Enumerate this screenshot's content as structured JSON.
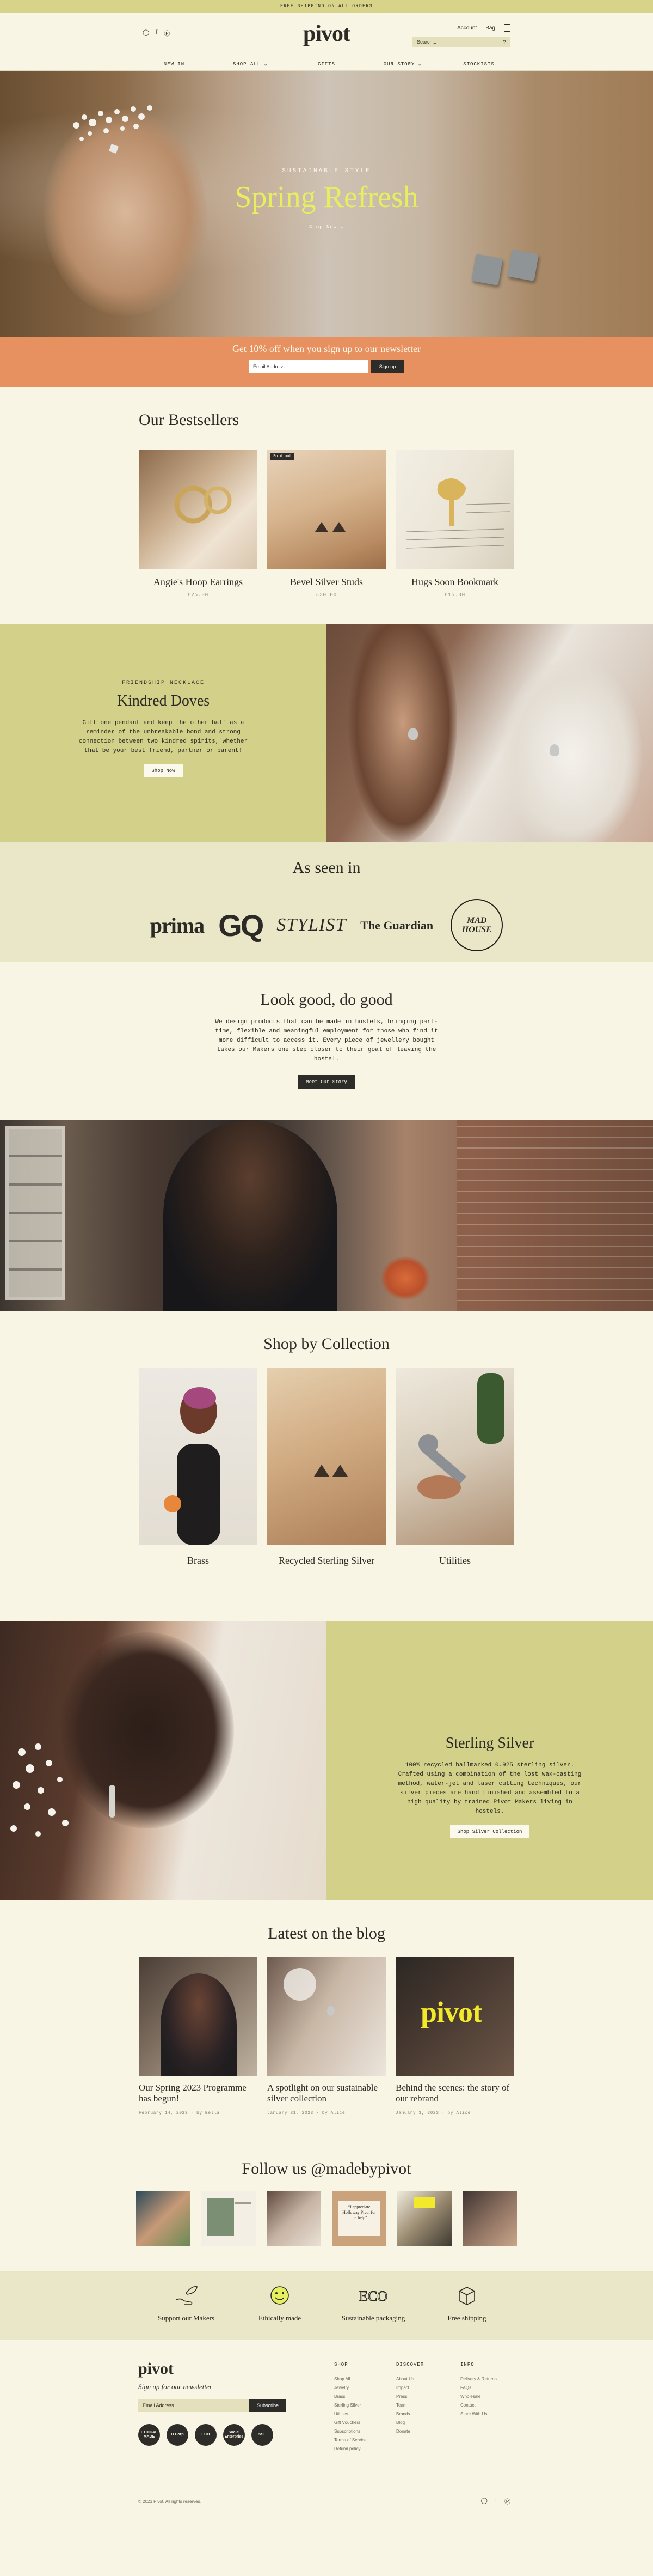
{
  "announcement": "FREE SHIPPING ON ALL ORDERS",
  "header": {
    "logo": "pivot",
    "account": "Account",
    "bag": "Bag",
    "search_placeholder": "Search...",
    "social": [
      "instagram-icon",
      "facebook-icon",
      "pinterest-icon"
    ]
  },
  "nav": [
    "NEW IN",
    "SHOP ALL ⌄",
    "GIFTS",
    "OUR STORY ⌄",
    "STOCKISTS"
  ],
  "hero": {
    "kicker": "SUSTAINABLE STYLE",
    "title": "Spring Refresh",
    "cta": "Shop Now →"
  },
  "newsletter_band": {
    "title": "Get 10% off when you sign up to our newsletter",
    "placeholder": "Email Address",
    "button": "Sign up"
  },
  "bestsellers": {
    "title": "Our Bestsellers",
    "items": [
      {
        "name": "Angie's Hoop Earrings",
        "price": "£25.00",
        "tag": ""
      },
      {
        "name": "Bevel Silver Studs",
        "price": "£30.00",
        "tag": "Sold out"
      },
      {
        "name": "Hugs Soon Bookmark",
        "price": "£15.00",
        "tag": ""
      }
    ]
  },
  "kindred": {
    "kicker": "FRIENDSHIP NECKLACE",
    "title": "Kindred Doves",
    "text": "Gift one pendant and keep the other half as a reminder of the unbreakable bond and strong connection between two kindred spirits, whether that be your best friend, partner or parent!",
    "button": "Shop Now"
  },
  "seen_in": {
    "title": "As seen in",
    "logos": [
      "prima",
      "GQ",
      "STYLIST",
      "The Guardian",
      "MAD HOUSE"
    ]
  },
  "look_good": {
    "title": "Look good, do good",
    "text": "We design products that can be made in hostels, bringing part-time, flexible and meaningful employment for those who find it more difficult to access it. Every piece of jewellery bought takes our Makers one step closer to their goal of leaving the hostel.",
    "button": "Meet Our Story"
  },
  "collection": {
    "title": "Shop by Collection",
    "items": [
      "Brass",
      "Recycled Sterling Silver",
      "Utilities"
    ]
  },
  "sterling": {
    "title": "Sterling Silver",
    "text": "100% recycled hallmarked 0.925 sterling silver. Crafted using a combination of the lost wax-casting method, water-jet and laser cutting techniques, our silver pieces are hand finished and assembled to a high quality by trained Pivot Makers living in hostels.",
    "button": "Shop Silver Collection"
  },
  "blog": {
    "title": "Latest on the blog",
    "posts": [
      {
        "title": "Our Spring 2023 Programme has begun!",
        "meta": "February 14, 2023 · by Bella"
      },
      {
        "title": "A spotlight on our sustainable silver collection",
        "meta": "January 31, 2023 · by Alice"
      },
      {
        "title": "Behind the scenes: the story of our rebrand",
        "meta": "January 3, 2023 · by Alice"
      }
    ]
  },
  "instagram": {
    "title": "Follow us @madebypivot",
    "tiles": [
      "photo",
      "photo",
      "photo",
      "photo",
      "photo",
      "photo"
    ],
    "tile4_text": "“I appreciate Holloway Pivot for the help”"
  },
  "features": [
    {
      "icon": "hands-leaf-icon",
      "label": "Support our Makers"
    },
    {
      "icon": "smiley-icon",
      "label": "Ethically made"
    },
    {
      "icon": "eco-icon",
      "label": "Sustainable packaging"
    },
    {
      "icon": "box-icon",
      "label": "Free shipping"
    }
  ],
  "footer": {
    "logo": "pivot",
    "signup": "Sign up for our newsletter",
    "placeholder": "Email Address",
    "button": "Subscribe",
    "badges": [
      "ETHICAL MADE",
      "B Corp",
      "ECO",
      "Social Enterprise",
      "SSE"
    ],
    "columns": [
      {
        "title": "SHOP",
        "links": [
          "Shop All",
          "Jewelry",
          "Brass",
          "Sterling Silver",
          "Utilities",
          "Gift Vouchers",
          "Subscriptions",
          "Terms of Service",
          "Refund policy"
        ]
      },
      {
        "title": "DISCOVER",
        "links": [
          "About Us",
          "Impact",
          "Press",
          "Team",
          "Brands",
          "Blog",
          "Donate"
        ]
      },
      {
        "title": "INFO",
        "links": [
          "Delivery & Returns",
          "FAQs",
          "Wholesale",
          "Contact",
          "Store With Us"
        ]
      }
    ],
    "copyright": "© 2023 Pivot. All rights reserved."
  },
  "colors": {
    "cream": "#f8f5e4",
    "olive": "#d3d08a",
    "orange": "#e6915f",
    "hero_title": "#e6ef5f",
    "dark": "#2d2c29"
  }
}
